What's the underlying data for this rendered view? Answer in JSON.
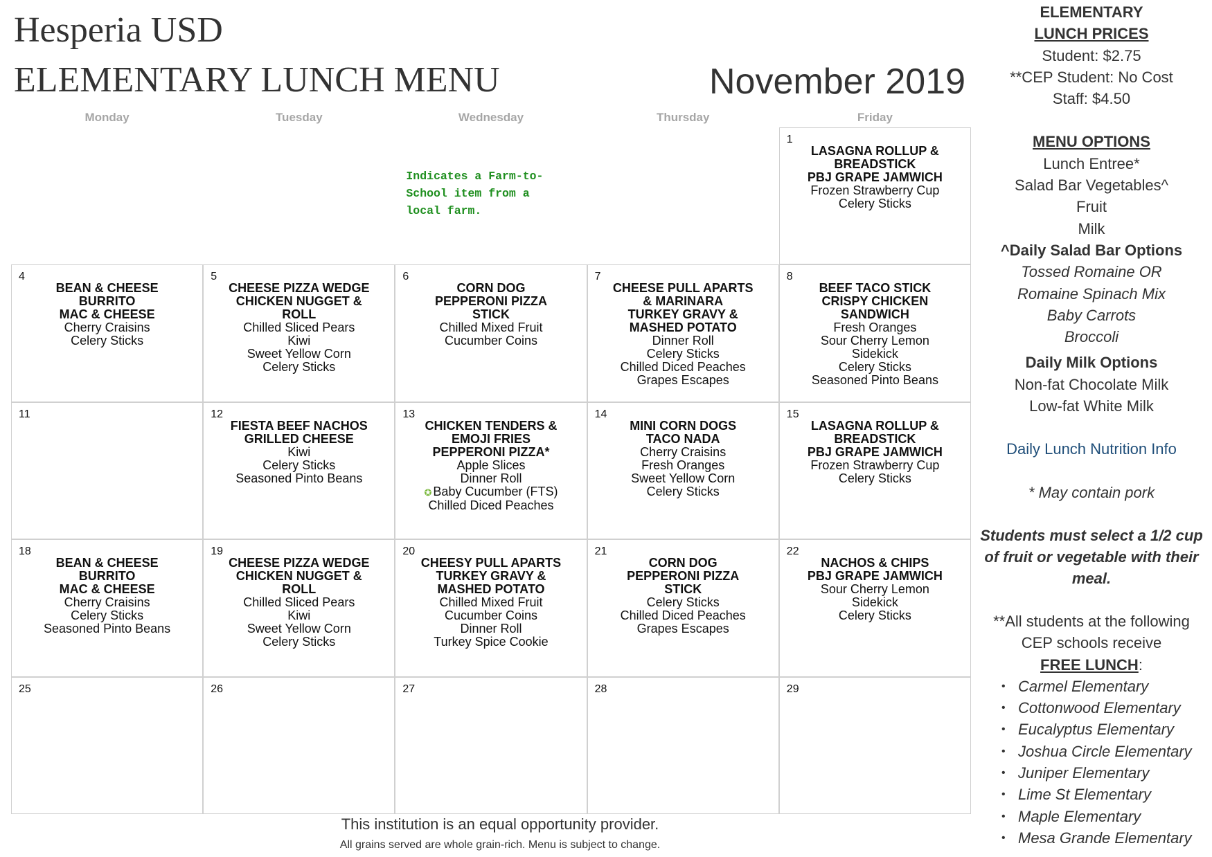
{
  "header": {
    "district": "Hesperia USD",
    "title": "ELEMENTARY LUNCH MENU",
    "month": "November 2019"
  },
  "days": [
    "Monday",
    "Tuesday",
    "Wednesday",
    "Thursday",
    "Friday"
  ],
  "fts_note": "Indicates a Farm-to-School item from a local farm.",
  "calendar": [
    {
      "num": "",
      "entrees": [],
      "sides": [],
      "empty": true
    },
    {
      "num": "",
      "entrees": [],
      "sides": [],
      "empty": true
    },
    {
      "num": "",
      "entrees": [],
      "sides": [],
      "empty": true,
      "note": true
    },
    {
      "num": "",
      "entrees": [],
      "sides": [],
      "empty": true
    },
    {
      "num": "1",
      "entrees": [
        "LASAGNA ROLLUP &",
        "BREADSTICK",
        "PBJ GRAPE JAMWICH"
      ],
      "sides": [
        "Frozen Strawberry Cup",
        "Celery Sticks"
      ]
    },
    {
      "num": "4",
      "entrees": [
        "BEAN & CHEESE",
        "BURRITO",
        "MAC & CHEESE"
      ],
      "sides": [
        "Cherry Craisins",
        "Celery Sticks"
      ]
    },
    {
      "num": "5",
      "entrees": [
        "CHEESE PIZZA WEDGE",
        "CHICKEN NUGGET &",
        "ROLL"
      ],
      "sides": [
        "Chilled Sliced Pears",
        "Kiwi",
        "Sweet Yellow Corn",
        "Celery Sticks"
      ]
    },
    {
      "num": "6",
      "entrees": [
        "CORN DOG",
        "PEPPERONI PIZZA",
        "STICK"
      ],
      "sides": [
        "Chilled Mixed Fruit",
        "Cucumber Coins"
      ]
    },
    {
      "num": "7",
      "entrees": [
        "CHEESE PULL APARTS",
        "& MARINARA",
        "TURKEY GRAVY &",
        "MASHED POTATO"
      ],
      "sides": [
        "Dinner Roll",
        "Celery Sticks",
        "Chilled Diced Peaches",
        "Grapes Escapes"
      ]
    },
    {
      "num": "8",
      "entrees": [
        "BEEF TACO STICK",
        "CRISPY CHICKEN",
        "SANDWICH"
      ],
      "sides": [
        "Fresh Oranges",
        "Sour Cherry Lemon",
        "Sidekick",
        "Celery Sticks",
        "Seasoned Pinto Beans"
      ]
    },
    {
      "num": "11",
      "entrees": [],
      "sides": []
    },
    {
      "num": "12",
      "entrees": [
        "FIESTA BEEF NACHOS",
        "GRILLED CHEESE"
      ],
      "sides": [
        "Kiwi",
        "Celery Sticks",
        "Seasoned Pinto Beans"
      ]
    },
    {
      "num": "13",
      "entrees": [
        "CHICKEN TENDERS &",
        "EMOJI FRIES",
        "PEPPERONI PIZZA*"
      ],
      "sides": [
        "Apple Slices",
        "Dinner Roll",
        "Baby Cucumber (FTS)",
        "Chilled Diced Peaches"
      ],
      "fts_index": 2
    },
    {
      "num": "14",
      "entrees": [
        "MINI CORN DOGS",
        "TACO NADA"
      ],
      "sides": [
        "Cherry Craisins",
        "Fresh Oranges",
        "Sweet Yellow Corn",
        "Celery Sticks"
      ]
    },
    {
      "num": "15",
      "entrees": [
        "LASAGNA ROLLUP &",
        "BREADSTICK",
        "PBJ GRAPE JAMWICH"
      ],
      "sides": [
        "Frozen Strawberry Cup",
        "Celery Sticks"
      ]
    },
    {
      "num": "18",
      "entrees": [
        "BEAN & CHEESE",
        "BURRITO",
        "MAC & CHEESE"
      ],
      "sides": [
        "Cherry Craisins",
        "Celery Sticks",
        "Seasoned Pinto Beans"
      ]
    },
    {
      "num": "19",
      "entrees": [
        "CHEESE PIZZA WEDGE",
        "CHICKEN NUGGET &",
        "ROLL"
      ],
      "sides": [
        "Chilled Sliced Pears",
        "Kiwi",
        "Sweet Yellow Corn",
        "Celery Sticks"
      ]
    },
    {
      "num": "20",
      "entrees": [
        "CHEESY PULL APARTS",
        "TURKEY GRAVY &",
        "MASHED POTATO"
      ],
      "sides": [
        "Chilled Mixed Fruit",
        "Cucumber Coins",
        "Dinner Roll",
        "Turkey Spice Cookie"
      ]
    },
    {
      "num": "21",
      "entrees": [
        "CORN DOG",
        "PEPPERONI PIZZA",
        "STICK"
      ],
      "sides": [
        "Celery Sticks",
        "Chilled Diced Peaches",
        "Grapes Escapes"
      ]
    },
    {
      "num": "22",
      "entrees": [
        "NACHOS & CHIPS",
        "PBJ GRAPE JAMWICH"
      ],
      "sides": [
        "Sour Cherry Lemon",
        "Sidekick",
        "Celery Sticks"
      ]
    },
    {
      "num": "25",
      "entrees": [],
      "sides": []
    },
    {
      "num": "26",
      "entrees": [],
      "sides": []
    },
    {
      "num": "27",
      "entrees": [],
      "sides": []
    },
    {
      "num": "28",
      "entrees": [],
      "sides": []
    },
    {
      "num": "29",
      "entrees": [],
      "sides": []
    }
  ],
  "footer": {
    "line1": "This institution is an equal opportunity provider.",
    "line2": "All grains served are whole grain-rich. Menu is subject to change."
  },
  "sidebar": {
    "prices_heading1": "ELEMENTARY",
    "prices_heading2": "LUNCH PRICES",
    "student_price": "Student: $2.75",
    "cep_price": "**CEP Student: No Cost",
    "staff_price": "Staff: $4.50",
    "options_heading": "MENU OPTIONS",
    "options": [
      "Lunch Entree*",
      "Salad Bar Vegetables^",
      "Fruit",
      "Milk"
    ],
    "salad_heading": "^Daily Salad Bar Options",
    "salad_options": [
      "Tossed Romaine OR",
      "Romaine Spinach Mix",
      "Baby Carrots",
      "Broccoli"
    ],
    "milk_heading": "Daily Milk Options",
    "milk_options": [
      "Non-fat Chocolate Milk",
      "Low-fat White Milk"
    ],
    "nutrition_link": "Daily Lunch Nutrition Info",
    "pork_note": "* May contain pork",
    "requirement": "Students must select a 1/2 cup of fruit or vegetable with their meal.",
    "cep_line1": "**All students at the following",
    "cep_line2": "CEP schools receive",
    "free_lunch": "FREE LUNCH",
    "free_lunch_colon": ":",
    "schools": [
      "Carmel Elementary",
      "Cottonwood Elementary",
      "Eucalyptus Elementary",
      "Joshua Circle Elementary",
      "Juniper Elementary",
      "Lime St Elementary",
      "Maple Elementary",
      "Mesa Grande Elementary"
    ]
  }
}
